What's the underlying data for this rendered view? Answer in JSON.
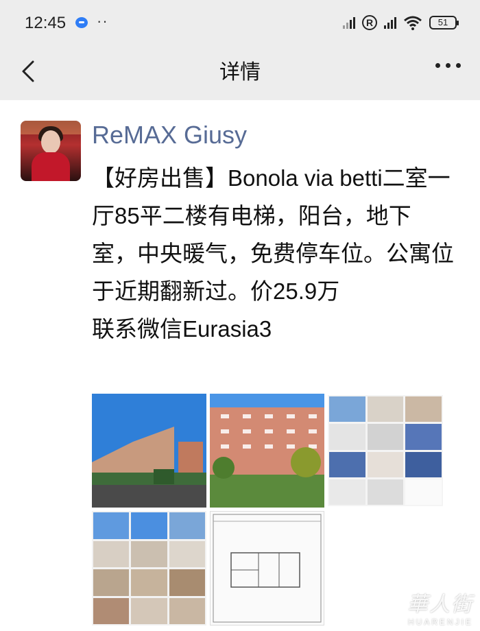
{
  "status": {
    "time": "12:45",
    "battery": "51",
    "extra": "··"
  },
  "nav": {
    "title": "详情"
  },
  "post": {
    "author": "ReMAX Giusy",
    "text": "【好房出售】Bonola via betti二室一厅85平二楼有电梯，阳台，地下室，中央暖气，免费停车位。公寓位于近期翻新过。价25.9万\n联系微信Eurasia3"
  },
  "watermark": {
    "cn": "華人街",
    "en": "HUARENJIE"
  },
  "colors": {
    "name": "#576b95",
    "nav_bg": "#ededed"
  },
  "icons": [
    "back-icon",
    "more-icon",
    "wifi-icon",
    "signal-icon",
    "battery-icon"
  ]
}
